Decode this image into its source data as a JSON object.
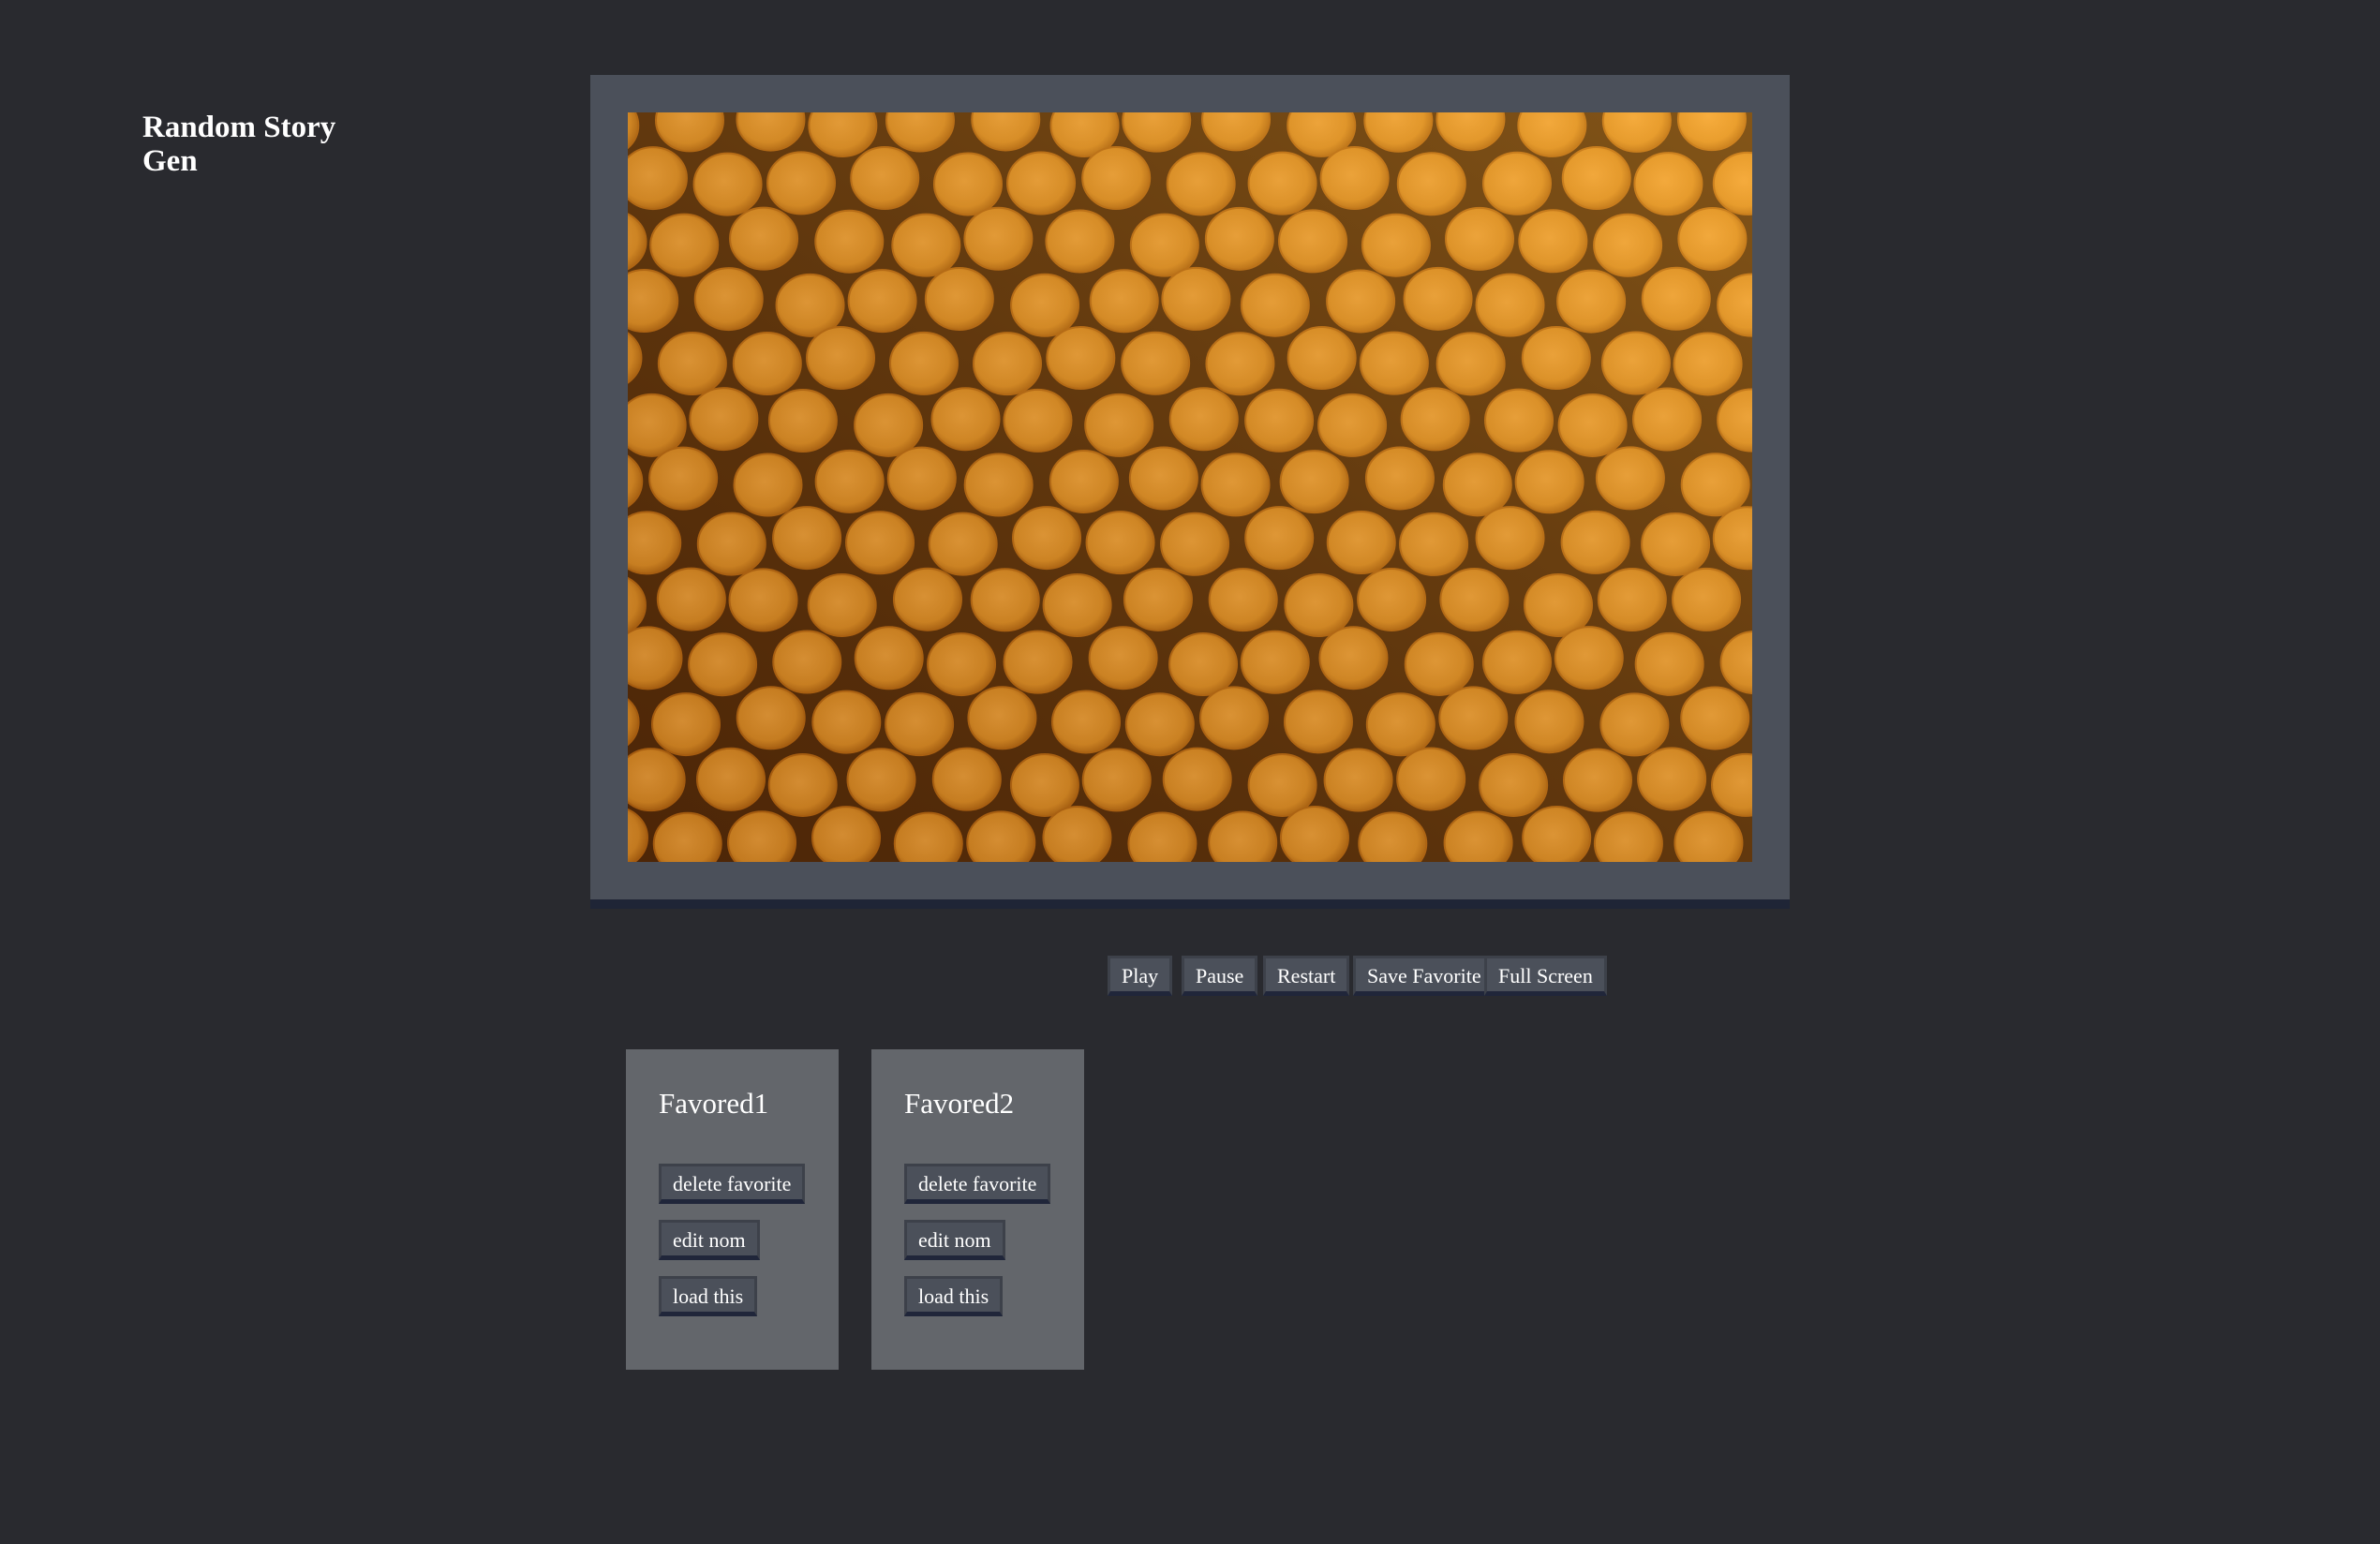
{
  "app": {
    "title": "Random Story Gen"
  },
  "viewer": {
    "image_description": "close-up of stacked orange cylindrical rods, honeycomb pattern",
    "colors": {
      "image_base": "#e08a1e",
      "frame": "#4b505a",
      "background": "#292a2f"
    }
  },
  "controls": {
    "play": "Play",
    "pause": "Pause",
    "restart": "Restart",
    "save_favorite": "Save Favorite",
    "full_screen": "Full Screen"
  },
  "favorites": [
    {
      "name": "Favored1",
      "delete": "delete favorite",
      "edit": "edit nom",
      "load": "load this"
    },
    {
      "name": "Favored2",
      "delete": "delete favorite",
      "edit": "edit nom",
      "load": "load this"
    }
  ]
}
